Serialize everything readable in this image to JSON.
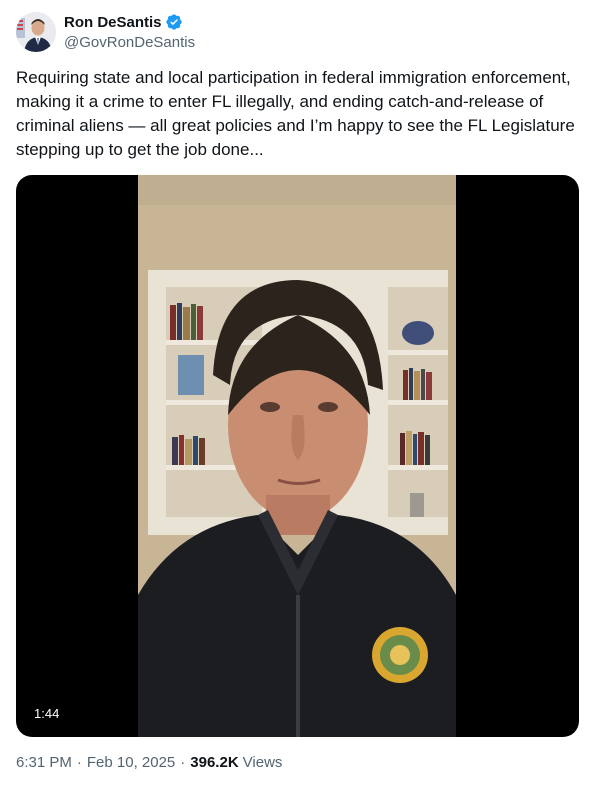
{
  "author": {
    "display_name": "Ron DeSantis",
    "handle": "@GovRonDeSantis",
    "verified_color": "#1d9bf0"
  },
  "tweet": {
    "text": "Requiring state and local participation in federal immigration enforcement, making it a crime to enter FL illegally, and ending catch-and-release of criminal aliens — all great policies and I’m happy to see the FL Legislature stepping up to get the job done..."
  },
  "media": {
    "type": "video",
    "duration": "1:44",
    "description_icon": "video-thumbnail"
  },
  "meta": {
    "time": "6:31 PM",
    "date": "Feb 10, 2025",
    "separator": "·",
    "views_count": "396.2K",
    "views_label": "Views"
  },
  "colors": {
    "text_primary": "#0f1419",
    "text_secondary": "#536471",
    "accent": "#1d9bf0"
  }
}
